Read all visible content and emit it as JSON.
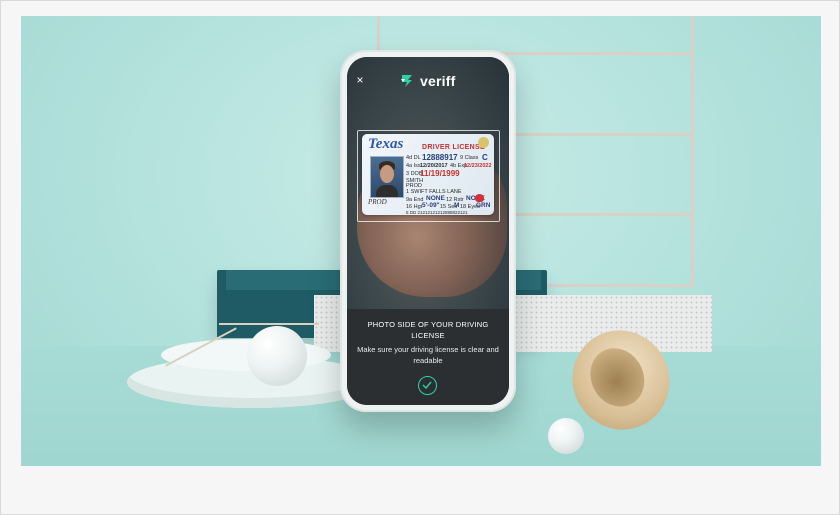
{
  "app": {
    "brand_name": "veriff",
    "close_glyph": "×",
    "icons": [
      "close-icon",
      "veriff-logo-icon",
      "check-circle-icon"
    ],
    "accent_color": "#30d0a7"
  },
  "id_card": {
    "state": "Texas",
    "type": "DRIVER LICENSE",
    "number_label": "4d DL",
    "number": "12888917",
    "class_label": "9 Class",
    "class_value": "C",
    "issued_label": "4a Iss",
    "issued": "12/20/2017",
    "expires_label": "4b Exp",
    "expires": "12/23/2022",
    "dob_label": "3 DOB",
    "dob": "11/19/1999",
    "name_last": "SMITH",
    "name_first": "PROD",
    "address": "1 SWIFT FALLS LANE",
    "endorsements_label": "9a End",
    "endorsements": "NONE",
    "restrictions_label": "12 Rstr",
    "restrictions": "NONE",
    "height_label": "16 Hgt",
    "height": "5'-09\"",
    "sex_label": "15 Sex",
    "sex": "M",
    "eyes_label": "18 Eyes",
    "eyes": "GRN",
    "dd": "5 DD 21212121212888822121"
  },
  "instructions": {
    "title": "PHOTO SIDE OF YOUR DRIVING LICENSE",
    "subtitle": "Make sure your driving license is clear and readable"
  }
}
